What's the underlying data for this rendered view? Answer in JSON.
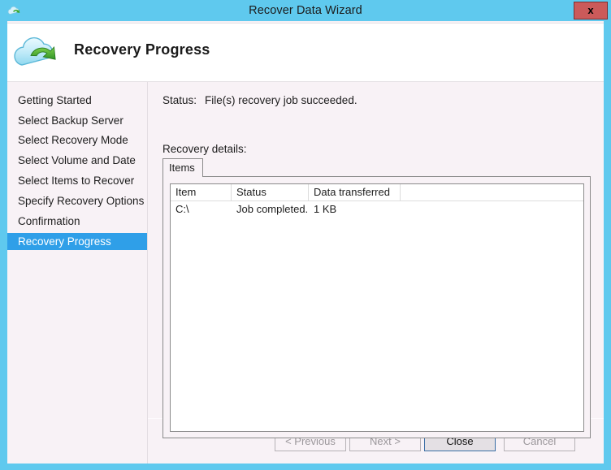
{
  "window": {
    "title": "Recover Data Wizard",
    "titlebar_icon": "cloud-recovery-icon",
    "close_label": "x"
  },
  "header": {
    "icon": "cloud-recovery-icon",
    "title": "Recovery Progress"
  },
  "sidebar": {
    "items": [
      {
        "label": "Getting Started",
        "selected": false
      },
      {
        "label": "Select Backup Server",
        "selected": false
      },
      {
        "label": "Select Recovery Mode",
        "selected": false
      },
      {
        "label": "Select Volume and Date",
        "selected": false
      },
      {
        "label": "Select Items to Recover",
        "selected": false
      },
      {
        "label": "Specify Recovery Options",
        "selected": false
      },
      {
        "label": "Confirmation",
        "selected": false
      },
      {
        "label": "Recovery Progress",
        "selected": true
      }
    ]
  },
  "main": {
    "status_label": "Status:",
    "status_value": "File(s) recovery job succeeded.",
    "details_label": "Recovery details:",
    "tabs": [
      {
        "label": "Items",
        "selected": true
      }
    ],
    "table": {
      "columns": [
        "Item",
        "Status",
        "Data transferred",
        ""
      ],
      "rows": [
        [
          "C:\\",
          "Job completed.",
          "1 KB",
          ""
        ]
      ]
    }
  },
  "footer": {
    "buttons": [
      {
        "label": "< Previous",
        "enabled": false
      },
      {
        "label": "Next >",
        "enabled": false
      },
      {
        "label": "Close",
        "enabled": true
      },
      {
        "label": "Cancel",
        "enabled": false
      }
    ]
  },
  "colors": {
    "titlebar": "#5fc9ee",
    "accent_selected": "#2f9fe8",
    "close_button": "#cb5a5a",
    "panel_background": "#f8f2f6",
    "default_button_border": "#3b6ea5"
  }
}
